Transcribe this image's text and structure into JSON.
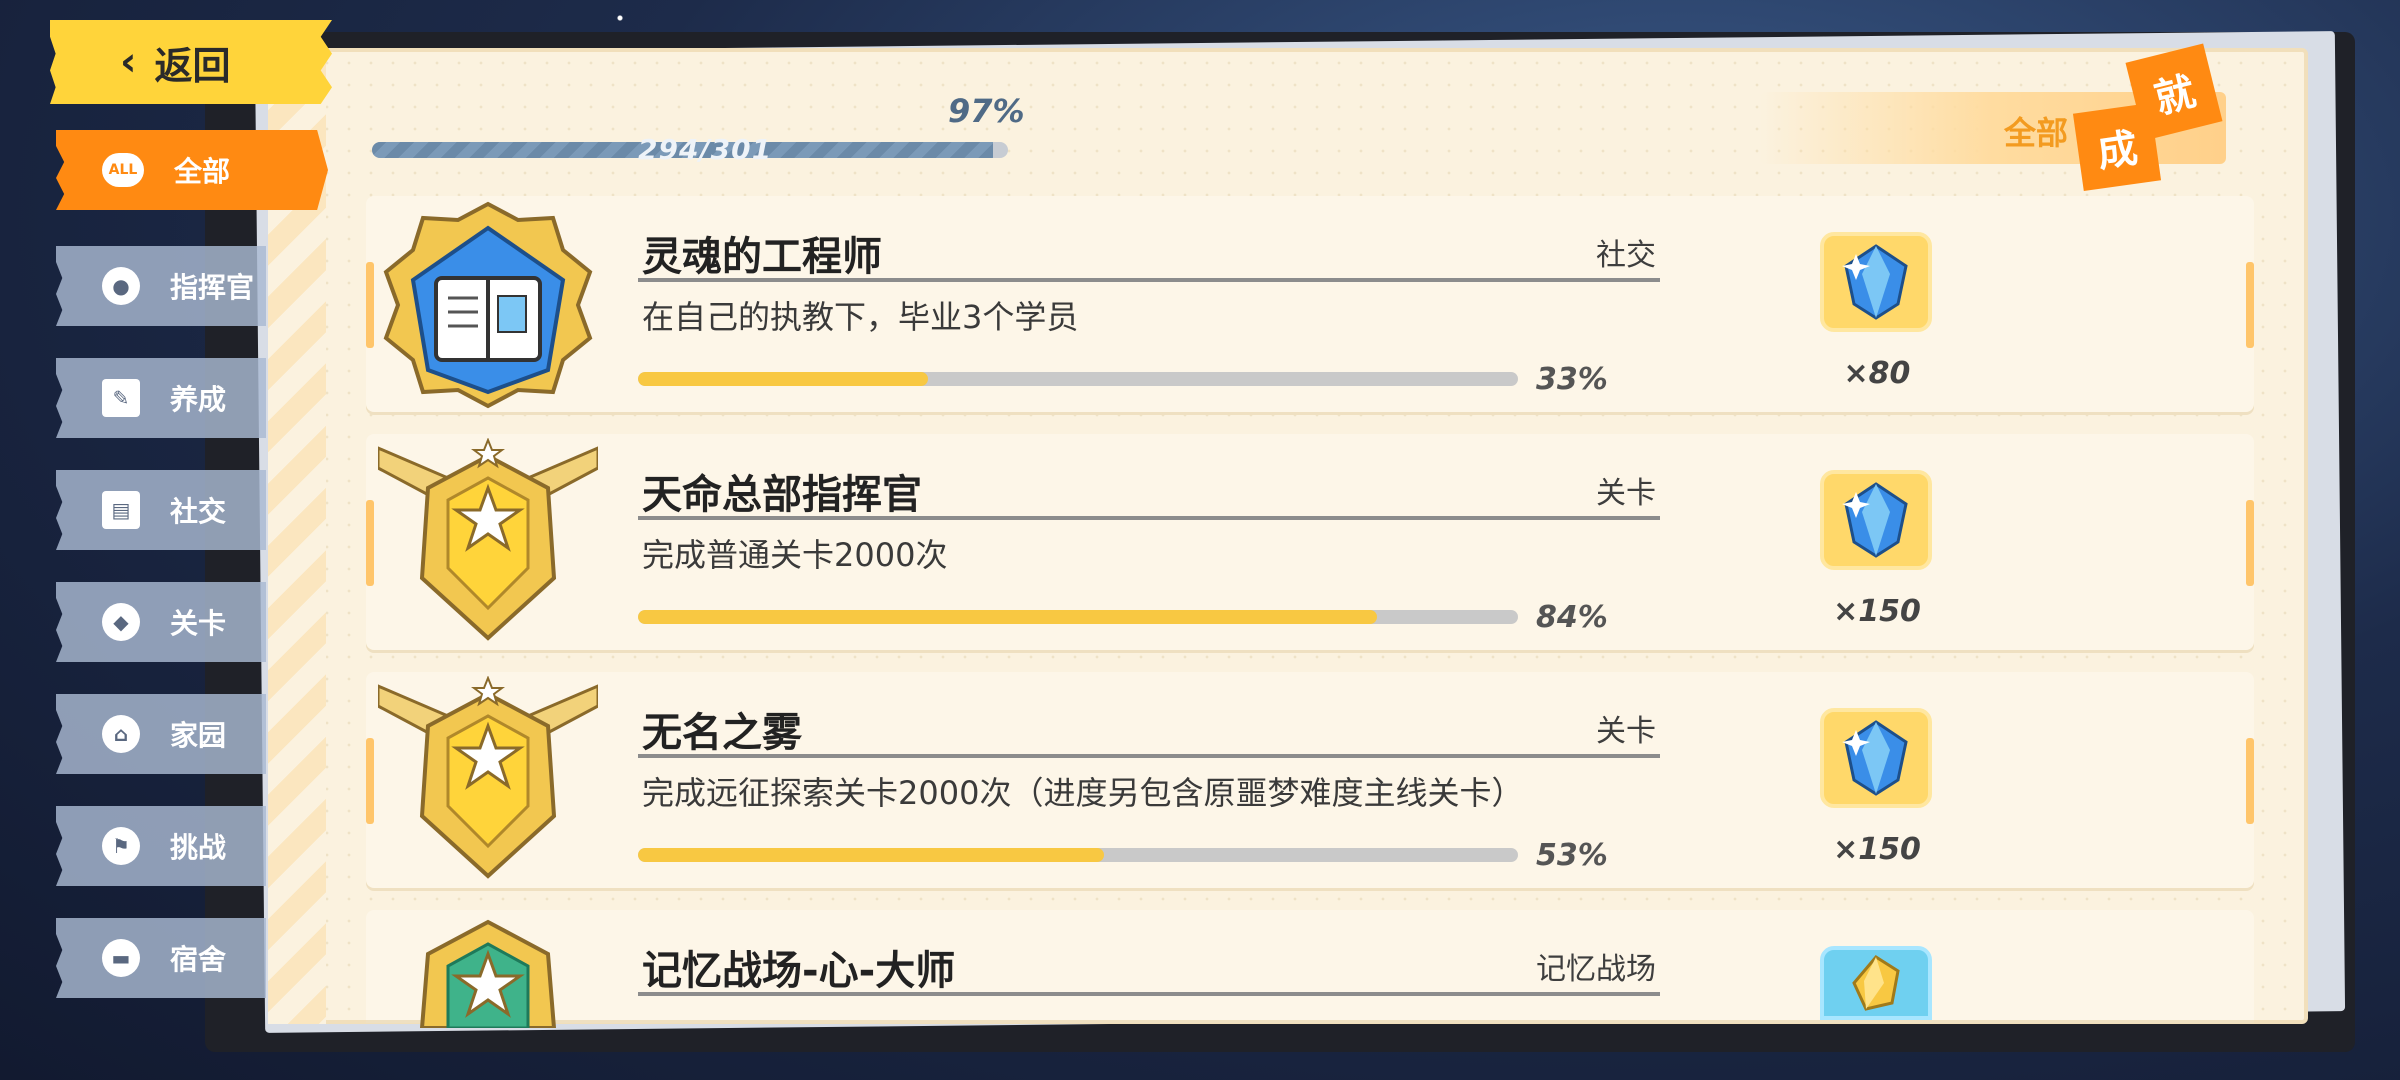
{
  "back": {
    "label": "返回"
  },
  "sidebar": {
    "items": [
      {
        "label": "全部",
        "icon": "all-icon",
        "icon_text": "ALL",
        "active": true
      },
      {
        "label": "指挥官",
        "icon": "user-icon"
      },
      {
        "label": "养成",
        "icon": "card-icon"
      },
      {
        "label": "社交",
        "icon": "id-card-icon"
      },
      {
        "label": "关卡",
        "icon": "map-pin-icon"
      },
      {
        "label": "家园",
        "icon": "home-icon"
      },
      {
        "label": "挑战",
        "icon": "flag-icon"
      },
      {
        "label": "宿舍",
        "icon": "bed-icon"
      }
    ]
  },
  "progress": {
    "percent_label": "97%",
    "count_label": "294/301",
    "fraction": 0.977
  },
  "header": {
    "filter_label": "全部",
    "badge_1": "成",
    "badge_2": "就"
  },
  "colors": {
    "accent": "#ff8a12",
    "progress_fill": "#f8c842",
    "gem": "#3a8ee8"
  },
  "achievements": [
    {
      "title": "灵魂的工程师",
      "category": "社交",
      "description": "在自己的执教下，毕业3个学员",
      "percent_label": "33%",
      "progress": 0.33,
      "reward_icon": "diamond-icon",
      "reward_count": "×80",
      "medal": "book-medal-icon"
    },
    {
      "title": "天命总部指挥官",
      "category": "关卡",
      "description": "完成普通关卡2000次",
      "percent_label": "84%",
      "progress": 0.84,
      "reward_icon": "diamond-icon",
      "reward_count": "×150",
      "medal": "winged-star-medal-icon"
    },
    {
      "title": "无名之雾",
      "category": "关卡",
      "description": "完成远征探索关卡2000次（进度另包含原噩梦难度主线关卡）",
      "percent_label": "53%",
      "progress": 0.53,
      "reward_icon": "diamond-icon",
      "reward_count": "×150",
      "medal": "winged-star-medal-icon"
    },
    {
      "title": "记忆战场-心-大师",
      "category": "记忆战场",
      "description": "",
      "percent_label": "",
      "progress": 0,
      "reward_icon": "gold-crystal-icon",
      "reward_count": "",
      "medal": "green-star-medal-icon"
    }
  ]
}
